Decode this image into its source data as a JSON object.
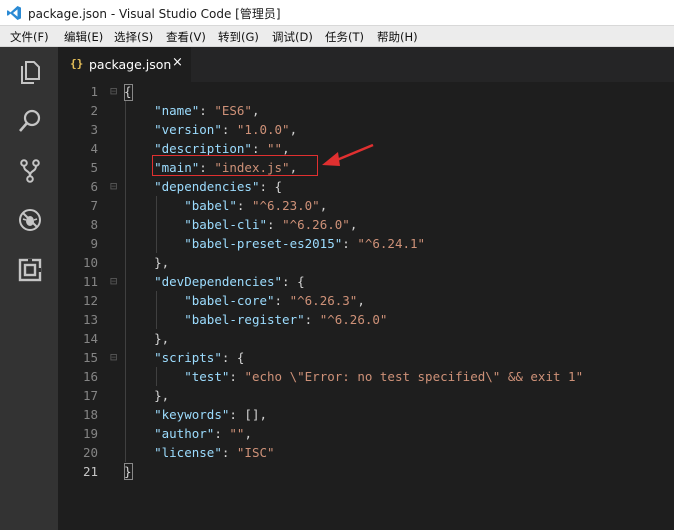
{
  "window": {
    "title": "package.json - Visual Studio Code [管理员]"
  },
  "menu": {
    "items": [
      {
        "label": "文件(F)"
      },
      {
        "label": "编辑(E)"
      },
      {
        "label": "选择(S)"
      },
      {
        "label": "查看(V)"
      },
      {
        "label": "转到(G)"
      },
      {
        "label": "调试(D)"
      },
      {
        "label": "任务(T)"
      },
      {
        "label": "帮助(H)"
      }
    ]
  },
  "activity_bar": {
    "icons": [
      "explorer-icon",
      "search-icon",
      "source-control-icon",
      "debug-icon",
      "extensions-icon"
    ]
  },
  "tab": {
    "icon": "{}",
    "label": "package.json",
    "close": "×"
  },
  "editor": {
    "current_line": 21,
    "line_numbers": [
      "1",
      "2",
      "3",
      "4",
      "5",
      "6",
      "7",
      "8",
      "9",
      "10",
      "11",
      "12",
      "13",
      "14",
      "15",
      "16",
      "17",
      "18",
      "19",
      "20",
      "21"
    ],
    "lines": [
      [
        {
          "t": "{",
          "c": "p"
        }
      ],
      [
        {
          "t": "    ",
          "c": "p"
        },
        {
          "t": "\"name\"",
          "c": "k"
        },
        {
          "t": ": ",
          "c": "p"
        },
        {
          "t": "\"ES6\"",
          "c": "s"
        },
        {
          "t": ",",
          "c": "p"
        }
      ],
      [
        {
          "t": "    ",
          "c": "p"
        },
        {
          "t": "\"version\"",
          "c": "k"
        },
        {
          "t": ": ",
          "c": "p"
        },
        {
          "t": "\"1.0.0\"",
          "c": "s"
        },
        {
          "t": ",",
          "c": "p"
        }
      ],
      [
        {
          "t": "    ",
          "c": "p"
        },
        {
          "t": "\"description\"",
          "c": "k"
        },
        {
          "t": ": ",
          "c": "p"
        },
        {
          "t": "\"\"",
          "c": "s"
        },
        {
          "t": ",",
          "c": "p"
        }
      ],
      [
        {
          "t": "    ",
          "c": "p"
        },
        {
          "t": "\"main\"",
          "c": "k"
        },
        {
          "t": ": ",
          "c": "p"
        },
        {
          "t": "\"index.js\"",
          "c": "s"
        },
        {
          "t": ",",
          "c": "p"
        }
      ],
      [
        {
          "t": "    ",
          "c": "p"
        },
        {
          "t": "\"dependencies\"",
          "c": "k"
        },
        {
          "t": ": {",
          "c": "p"
        }
      ],
      [
        {
          "t": "        ",
          "c": "p"
        },
        {
          "t": "\"babel\"",
          "c": "k"
        },
        {
          "t": ": ",
          "c": "p"
        },
        {
          "t": "\"^6.23.0\"",
          "c": "s"
        },
        {
          "t": ",",
          "c": "p"
        }
      ],
      [
        {
          "t": "        ",
          "c": "p"
        },
        {
          "t": "\"babel-cli\"",
          "c": "k"
        },
        {
          "t": ": ",
          "c": "p"
        },
        {
          "t": "\"^6.26.0\"",
          "c": "s"
        },
        {
          "t": ",",
          "c": "p"
        }
      ],
      [
        {
          "t": "        ",
          "c": "p"
        },
        {
          "t": "\"babel-preset-es2015\"",
          "c": "k"
        },
        {
          "t": ": ",
          "c": "p"
        },
        {
          "t": "\"^6.24.1\"",
          "c": "s"
        }
      ],
      [
        {
          "t": "    },",
          "c": "p"
        }
      ],
      [
        {
          "t": "    ",
          "c": "p"
        },
        {
          "t": "\"devDependencies\"",
          "c": "k"
        },
        {
          "t": ": {",
          "c": "p"
        }
      ],
      [
        {
          "t": "        ",
          "c": "p"
        },
        {
          "t": "\"babel-core\"",
          "c": "k"
        },
        {
          "t": ": ",
          "c": "p"
        },
        {
          "t": "\"^6.26.3\"",
          "c": "s"
        },
        {
          "t": ",",
          "c": "p"
        }
      ],
      [
        {
          "t": "        ",
          "c": "p"
        },
        {
          "t": "\"babel-register\"",
          "c": "k"
        },
        {
          "t": ": ",
          "c": "p"
        },
        {
          "t": "\"^6.26.0\"",
          "c": "s"
        }
      ],
      [
        {
          "t": "    },",
          "c": "p"
        }
      ],
      [
        {
          "t": "    ",
          "c": "p"
        },
        {
          "t": "\"scripts\"",
          "c": "k"
        },
        {
          "t": ": {",
          "c": "p"
        }
      ],
      [
        {
          "t": "        ",
          "c": "p"
        },
        {
          "t": "\"test\"",
          "c": "k"
        },
        {
          "t": ": ",
          "c": "p"
        },
        {
          "t": "\"echo \\\"Error: no test specified\\\" && exit 1\"",
          "c": "s"
        }
      ],
      [
        {
          "t": "    },",
          "c": "p"
        }
      ],
      [
        {
          "t": "    ",
          "c": "p"
        },
        {
          "t": "\"keywords\"",
          "c": "k"
        },
        {
          "t": ": [],",
          "c": "p"
        }
      ],
      [
        {
          "t": "    ",
          "c": "p"
        },
        {
          "t": "\"author\"",
          "c": "k"
        },
        {
          "t": ": ",
          "c": "p"
        },
        {
          "t": "\"\"",
          "c": "s"
        },
        {
          "t": ",",
          "c": "p"
        }
      ],
      [
        {
          "t": "    ",
          "c": "p"
        },
        {
          "t": "\"license\"",
          "c": "k"
        },
        {
          "t": ": ",
          "c": "p"
        },
        {
          "t": "\"ISC\"",
          "c": "s"
        }
      ],
      [
        {
          "t": "}",
          "c": "p"
        }
      ]
    ]
  },
  "annotation": {
    "highlight_color": "#e03030"
  }
}
